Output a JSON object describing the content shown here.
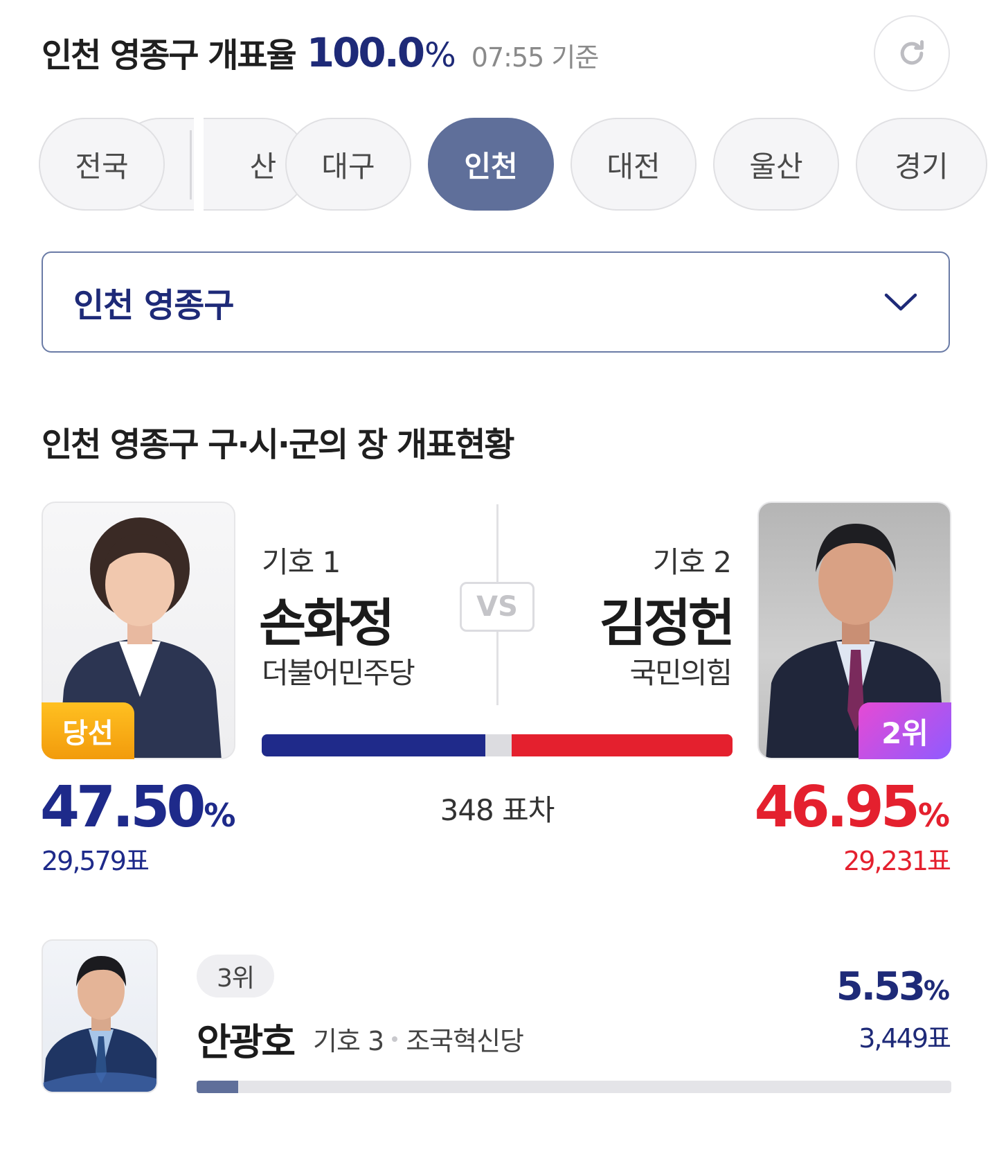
{
  "header": {
    "title": "인천 영종구 개표율",
    "rate": "100.0",
    "rate_unit": "%",
    "time": "07:55 기준",
    "refresh_icon": "refresh-icon"
  },
  "region_tabs": [
    {
      "label": "전국",
      "active": false
    },
    {
      "label": "산",
      "active": false
    },
    {
      "label": "대구",
      "active": false
    },
    {
      "label": "인천",
      "active": true
    },
    {
      "label": "대전",
      "active": false
    },
    {
      "label": "울산",
      "active": false
    },
    {
      "label": "경기",
      "active": false
    }
  ],
  "district_select": {
    "value": "인천 영종구",
    "icon": "chevron-down-icon"
  },
  "section_title": "인천 영종구 구·시·군의 장 개표현황",
  "vs_label": "VS",
  "margin_text": "348 표차",
  "candidates": [
    {
      "number_label": "기호 1",
      "name": "손화정",
      "party": "더불어민주당",
      "badge": "당선",
      "percent": "47.50",
      "percent_unit": "%",
      "votes": "29,579표",
      "share": 0.475,
      "color": "#1f2a8a"
    },
    {
      "number_label": "기호 2",
      "name": "김정헌",
      "party": "국민의힘",
      "badge": "2위",
      "percent": "46.95",
      "percent_unit": "%",
      "votes": "29,231표",
      "share": 0.4695,
      "color": "#e4202e"
    },
    {
      "rank": "3위",
      "name": "안광호",
      "number_label": "기호 3",
      "party": "조국혁신당",
      "percent": "5.53",
      "percent_unit": "%",
      "votes": "3,449표",
      "share": 0.0553,
      "color": "#5f6f9a"
    }
  ]
}
